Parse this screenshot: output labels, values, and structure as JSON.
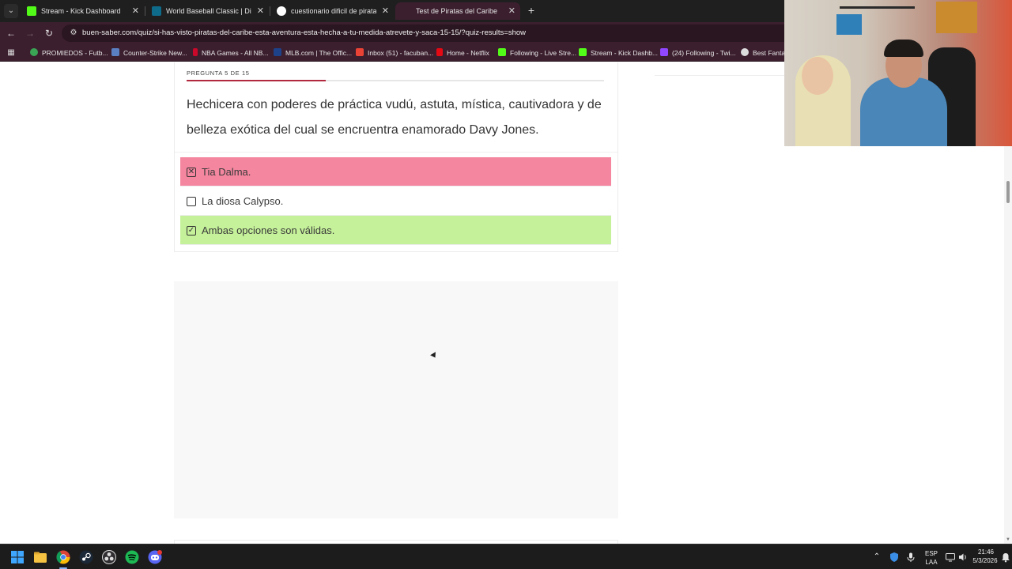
{
  "browser": {
    "tabs": [
      {
        "title": "Stream - Kick Dashboard",
        "favicon_color": "#53fc18",
        "active": false
      },
      {
        "title": "World Baseball Classic | Disney",
        "favicon_color": "#0f6b8a",
        "active": false
      },
      {
        "title": "cuestionario dificil de piratas del",
        "favicon_color": "#ffffff",
        "active": false
      },
      {
        "title": "Test de Piratas del Caribe",
        "favicon_color": "#b2283e",
        "active": true
      }
    ],
    "new_tab_symbol": "+",
    "close_symbol": "✕",
    "url": "buen-saber.com/quiz/si-has-visto-piratas-del-caribe-esta-aventura-esta-hecha-a-tu-medida-atrevete-y-saca-15-15/?quiz-results=show",
    "bookmarks": [
      {
        "label": "PROMIEDOS - Futb...",
        "icon_color": "#3aa655"
      },
      {
        "label": "Counter-Strike New...",
        "icon_color": "#5a7fc2"
      },
      {
        "label": "NBA Games - All NB...",
        "icon_color": "#c9082a"
      },
      {
        "label": "MLB.com | The Offic...",
        "icon_color": "#1d428a"
      },
      {
        "label": "Inbox (51) - facuban...",
        "icon_color": "#ea4335"
      },
      {
        "label": "Home - Netflix",
        "icon_color": "#e50914"
      },
      {
        "label": "Following - Live Stre...",
        "icon_color": "#53fc18"
      },
      {
        "label": "Stream - Kick Dashb...",
        "icon_color": "#53fc18"
      },
      {
        "label": "(24) Following - Twi...",
        "icon_color": "#9146ff"
      },
      {
        "label": "Best Fantas",
        "icon_color": "#dddddd"
      }
    ]
  },
  "quiz": {
    "progress_label": "PREGUNTA 5 DE 15",
    "progress_fraction": 0.333,
    "progress_color": "#b2283e",
    "question": "Hechicera con poderes de práctica vudú, astuta, mística, cautivadora y de belleza exótica del cual se encruentra enamorado Davy Jones.",
    "answers": [
      {
        "text": "Tia Dalma.",
        "state": "wrong",
        "mark": "✕",
        "color": "#f4869f"
      },
      {
        "text": "La diosa Calypso.",
        "state": "neutral",
        "mark": "",
        "color": "#ffffff"
      },
      {
        "text": "Ambas opciones son válidas.",
        "state": "right",
        "mark": "✓",
        "color": "#c5f19a"
      }
    ]
  },
  "taskbar": {
    "language": "ESP",
    "layout": "LAA",
    "time": "21:46",
    "date": "5/3/2026",
    "icons": [
      "windows-start-icon",
      "file-explorer-icon",
      "chrome-icon",
      "steam-icon",
      "obs-icon",
      "spotify-icon",
      "discord-icon"
    ]
  }
}
